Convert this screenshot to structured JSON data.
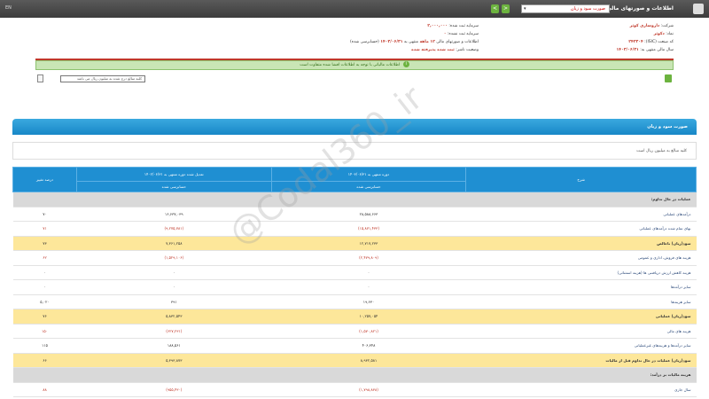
{
  "topbar": {
    "title": "اطلاعات و صورتهای مالی",
    "selected_report": "صورت سود و زیان",
    "left_text": "EN",
    "prev_label": "<",
    "next_label": ">"
  },
  "info": {
    "company_label": "شرکت:",
    "company_value": "داروسازی کوثر",
    "symbol_label": "نماد:",
    "symbol_value": "دکوثر",
    "isic_label": "کد صنعت (ISIC):",
    "isic_value": "۲۴۲۳۰۴",
    "year_end_label": "سال مالی منتهی به:",
    "year_end_value": "۱۴۰۳/۰۶/۳۱",
    "capital_label": "سرمایه ثبت شده:",
    "capital_value": "۲,۰۰۰,۰۰۰",
    "unregistered_label": "سرمایه ثبت نشده:",
    "unregistered_value": "۰",
    "period_label": "اطلاعات و صورتهای مالی",
    "period_value": "۱۲ ماهه",
    "period_end_label": "منتهی به",
    "period_end_value": "۱۴۰۳/۰۶/۳۱",
    "audit_value": "(حسابرسی شده)",
    "status_label": "وضعیت ناشر:",
    "status_value": "ثبت شده پذیرفته شده"
  },
  "banner": {
    "text": "اطلاعات مالیاتی با توجه به اطلاعات افشا شده متفاوت است"
  },
  "filter": {
    "placeholder": "کلیه مبالغ درج شده به میلیون ریال می باشد"
  },
  "section": {
    "title": "صورت سود و زیان",
    "note": "کلیه مبالغ به میلیون ریال است"
  },
  "table": {
    "header_desc": "شرح",
    "header_current": "دوره منتهی به ۱۴۰۳/۰۶/۳۱",
    "header_previous": "تعدیل شده دوره منتهی به ۱۴۰۲/۰۶/۳۱",
    "header_change": "درصد تغییر",
    "sub_current": "حسابرسی شده",
    "sub_previous": "حسابرسی شده",
    "rows": [
      {
        "type": "group",
        "desc": "عملیات در حال تداوم:",
        "cur": "",
        "prev": "",
        "chg": ""
      },
      {
        "type": "normal",
        "desc": "درآمدهای عملیاتی",
        "cur": "۲۸,۵۸۸,۶۶۳",
        "prev": "۱۶,۶۳۷,۰۳۹",
        "chg": "۷۰",
        "neg": false
      },
      {
        "type": "normal",
        "desc": "بهای تمام شده درآمدهای عملیاتی",
        "cur": "(۱۵,۸۷۱,۴۳۳)",
        "prev": "(۹,۲۷۵,۷۸۱)",
        "chg": "۷۱",
        "neg": true
      },
      {
        "type": "hl",
        "desc": "سود(زیان) ناخالص",
        "cur": "۱۲,۷۱۷,۲۳۳",
        "prev": "۷,۳۶۱,۲۵۸",
        "chg": "۷۳",
        "neg": false
      },
      {
        "type": "normal",
        "desc": "هزینه های فروش، اداری و عمومی",
        "cur": "(۲,۴۷۹,۸۰۹)",
        "prev": "(۱,۵۲۹,۱۰۶)",
        "chg": "۶۲",
        "neg": true
      },
      {
        "type": "normal",
        "desc": "هزینه کاهش ارزش دریافتنی ها (هزینه استثنائی)",
        "cur": "۰",
        "prev": "۰",
        "chg": "۰",
        "neg": false
      },
      {
        "type": "normal",
        "desc": "سایر درآمدها",
        "cur": "۰",
        "prev": "۰",
        "chg": "۰",
        "neg": false
      },
      {
        "type": "normal",
        "desc": "سایر هزینه‌ها",
        "cur": "۱۹,۶۳۰",
        "prev": "۳۹۱",
        "chg": "۵,۰۲۰",
        "neg": false
      },
      {
        "type": "hl",
        "desc": "سود(زیان) عملیاتی",
        "cur": "۱۰,۲۵۷,۰۵۴",
        "prev": "۵,۸۳۲,۵۴۳",
        "chg": "۷۶",
        "neg": false
      },
      {
        "type": "normal",
        "desc": "هزینه های مالی",
        "cur": "(۱,۵۷۰,۸۲۱)",
        "prev": "(۶۲۷,۲۳۱)",
        "chg": "۱۵۰",
        "neg": true
      },
      {
        "type": "normal",
        "desc": "سایر درآمدها و هزینه‌های غیرعملیاتی",
        "cur": "۴۰۶,۳۴۸",
        "prev": "۱۸۸,۵۶۱",
        "chg": "۱۱۵",
        "neg": false
      },
      {
        "type": "hl",
        "desc": "سود(زیان) عملیات در حال تداوم قبل از مالیات",
        "cur": "۸,۹۳۲,۵۸۱",
        "prev": "۵,۳۹۳,۸۷۳",
        "chg": "۶۶",
        "neg": false
      },
      {
        "type": "group",
        "desc": "هزینه مالیات بر درآمد:",
        "cur": "",
        "prev": "",
        "chg": ""
      },
      {
        "type": "normal",
        "desc": "سال جاری",
        "cur": "(۱,۷۹۸,۸۳۸)",
        "prev": "(۹۵۵,۴۳۰)",
        "chg": "۸۸",
        "neg": true
      }
    ]
  },
  "watermark": "@Codal360_ir"
}
